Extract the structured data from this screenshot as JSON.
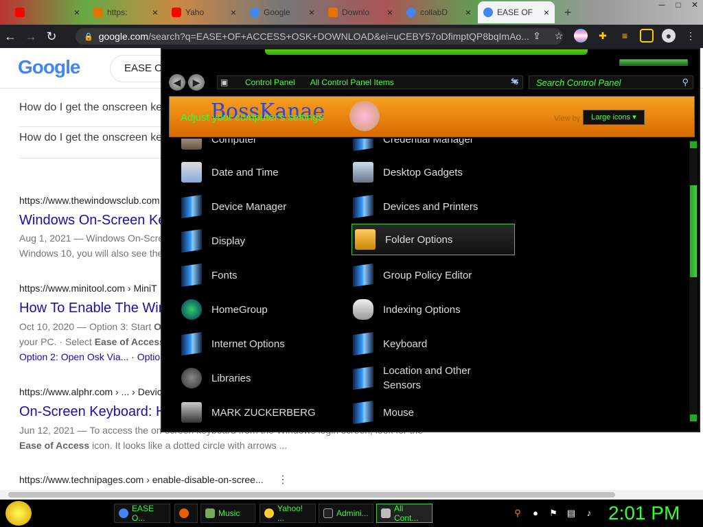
{
  "tabs": [
    {
      "label": "",
      "favicon": "youtube-icon",
      "color": "#ff0000"
    },
    {
      "label": "https:",
      "favicon": "mic-icon",
      "color": "#e37400"
    },
    {
      "label": "Yaho",
      "favicon": "youtube-icon",
      "color": "#ff0000"
    },
    {
      "label": "Google",
      "favicon": "chrome-icon",
      "color": "#4285f4"
    },
    {
      "label": "Downlo",
      "favicon": "download-icon",
      "color": "#e37400"
    },
    {
      "label": "collabD",
      "favicon": "chrome-icon",
      "color": "#4285f4"
    },
    {
      "label": "EASE OF",
      "favicon": "google-icon",
      "color": "#4285f4",
      "active": true
    }
  ],
  "address": {
    "host": "google.com",
    "path": "/search?q=EASE+OF+ACCESS+OSK+DOWNLOAD&ei=uCEBY57oDfimptQP8bqImAo..."
  },
  "google": {
    "logo": "Google",
    "search_value": "EASE O",
    "q1": "How do I get the onscreen ke",
    "q2": "How do I get the onscreen ke",
    "r1": {
      "url": "https://www.thewindowsclub.com",
      "title": "Windows On-Screen Ke",
      "snip1": "Aug 1, 2021 — Windows On-Scree",
      "snip2": "Windows 10, you will also see the"
    },
    "r2": {
      "url": "https://www.minitool.com › MiniT",
      "title": "How To Enable The Win",
      "snip1a": "Oct 10, 2020 — Option 3: Start ",
      "snip1b": "OS",
      "snip2a": "your PC. · Select ",
      "snip2b": "Ease of Access",
      "snip2c": ".",
      "links": "Option 2: Open Osk Via... · Option"
    },
    "r3": {
      "url": "https://www.alphr.com › ... › Devic",
      "title": "On-Screen Keyboard: H",
      "snip1": "Jun 12, 2021 — To access the on-screen keyboard from the Windows login screen, look for the",
      "snip2a": "Ease of Access",
      "snip2b": " icon. It looks like a dotted circle with arrows ..."
    },
    "r4": {
      "url": "https://www.technipages.com › enable-disable-on-scree..."
    }
  },
  "control_panel": {
    "breadcrumb": [
      "Control Panel",
      "All Control Panel Items"
    ],
    "search_placeholder": "Search Control Panel",
    "banner_logo": "BossKanae",
    "banner_subtitle": "Adjust your computer's settings",
    "view_by_label": "View by",
    "view_by_value": "Large icons",
    "items_left": [
      {
        "label": "Computer",
        "icon": "computer-icon"
      },
      {
        "label": "Date and Time",
        "icon": "clock-icon"
      },
      {
        "label": "Device Manager",
        "icon": "device-manager-icon"
      },
      {
        "label": "Display",
        "icon": "display-icon"
      },
      {
        "label": "Fonts",
        "icon": "fonts-icon"
      },
      {
        "label": "HomeGroup",
        "icon": "globe-icon"
      },
      {
        "label": "Internet Options",
        "icon": "internet-icon"
      },
      {
        "label": "Libraries",
        "icon": "libraries-icon"
      },
      {
        "label": "MARK ZUCKERBERG",
        "icon": "user-icon"
      }
    ],
    "items_right": [
      {
        "label": "Credential Manager",
        "icon": "credential-icon"
      },
      {
        "label": "Desktop Gadgets",
        "icon": "gadgets-icon"
      },
      {
        "label": "Devices and Printers",
        "icon": "printer-icon"
      },
      {
        "label": "Folder Options",
        "icon": "folder-icon",
        "selected": true
      },
      {
        "label": "Group Policy Editor",
        "icon": "policy-icon"
      },
      {
        "label": "Indexing Options",
        "icon": "indexing-icon"
      },
      {
        "label": "Keyboard",
        "icon": "keyboard-icon"
      },
      {
        "label": "Location and Other Sensors",
        "icon": "location-icon"
      },
      {
        "label": "Mouse",
        "icon": "mouse-icon"
      }
    ]
  },
  "taskbar": {
    "buttons": [
      {
        "label": "EASE O...",
        "icon": "chrome-icon"
      },
      {
        "label": "",
        "icon": "firefox-icon"
      },
      {
        "label": "Music",
        "icon": "music-icon"
      },
      {
        "label": "Yahoo! ...",
        "icon": "yahoo-icon"
      },
      {
        "label": "Admini...",
        "icon": "cmd-icon"
      },
      {
        "label": "All Cont...",
        "icon": "control-panel-icon"
      }
    ],
    "clock": "2:01 PM"
  },
  "colors": {
    "accent": "#33ff33",
    "link": "#1a0dab",
    "banner": "#f7a020"
  }
}
